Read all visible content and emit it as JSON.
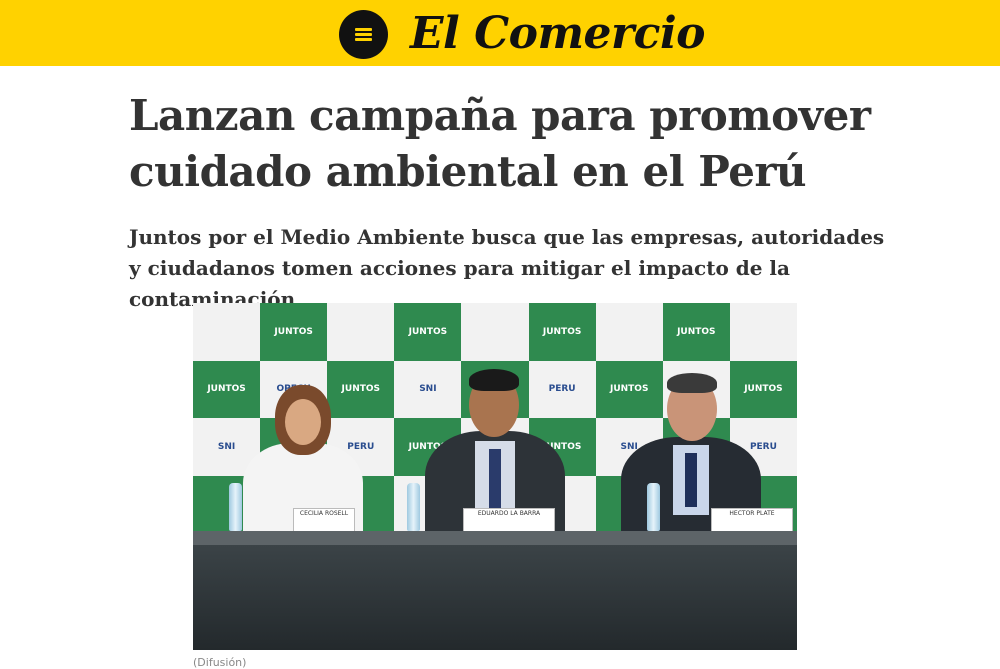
{
  "header": {
    "logo_text": "El Comercio",
    "menu_icon": "hamburger-menu-icon",
    "background_color": "#ffd200"
  },
  "article": {
    "headline": "Lanzan campaña para promover cuidado ambiental en el Perú",
    "subheadline": "Juntos por el Medio Ambiente busca que las empresas, autoridades y ciudadanos tomen acciones para mitigar el impacto de la contaminación",
    "photo_caption": "(Difusión)"
  },
  "photo": {
    "backdrop_logos": [
      "JUNTOS",
      "OPECU",
      "SNI",
      "PERU"
    ],
    "nameplates": [
      "CECILIA ROSELL",
      "EDUARDO LA BARRA",
      "HECTOR PLATE"
    ]
  }
}
